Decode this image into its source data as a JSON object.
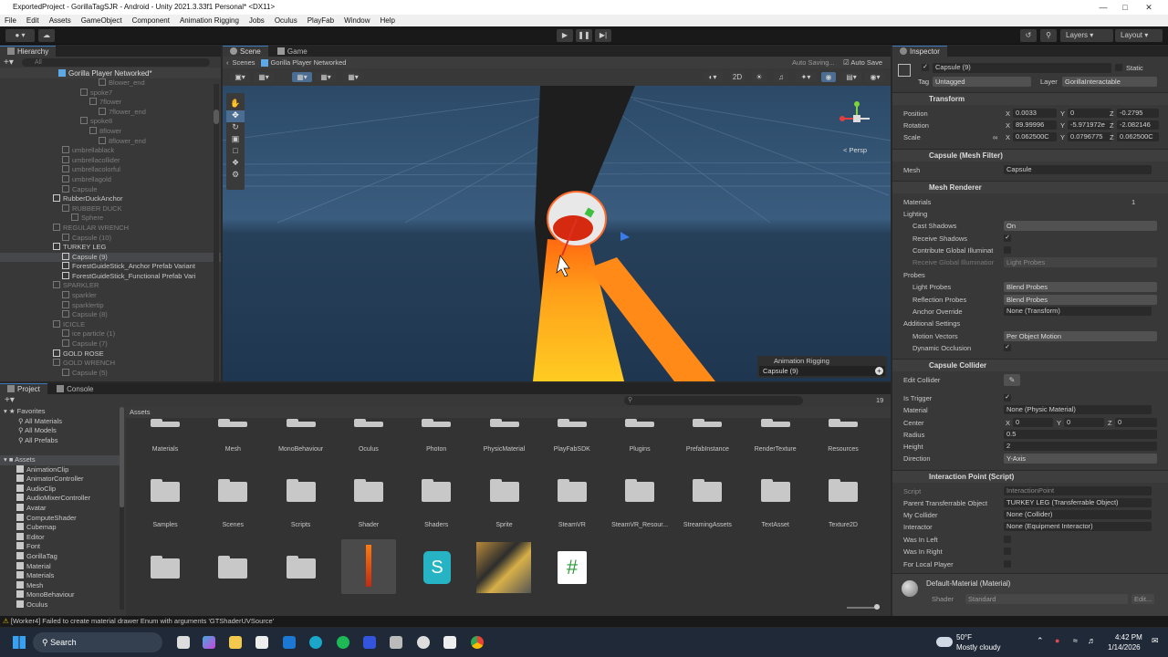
{
  "titlebar": {
    "title": "ExportedProject - GorillaTagSJR - Android - Unity 2021.3.33f1 Personal* <DX11>"
  },
  "menu": [
    "File",
    "Edit",
    "Assets",
    "GameObject",
    "Component",
    "Animation Rigging",
    "Jobs",
    "Oculus",
    "PlayFab",
    "Window",
    "Help"
  ],
  "toolbar": {
    "layers": "Layers",
    "layout": "Layout"
  },
  "hierarchy": {
    "tab": "Hierarchy",
    "search_placeholder": "All",
    "scene_name": "Gorilla Player Networked*",
    "rows": [
      {
        "label": "Blower_end",
        "indent": 9,
        "dim": true
      },
      {
        "label": "spoke7",
        "indent": 7,
        "dim": true
      },
      {
        "label": "7flower",
        "indent": 8,
        "dim": true
      },
      {
        "label": "7flower_end",
        "indent": 9,
        "dim": true
      },
      {
        "label": "spoke8",
        "indent": 7,
        "dim": true
      },
      {
        "label": "8flower",
        "indent": 8,
        "dim": true
      },
      {
        "label": "8flower_end",
        "indent": 9,
        "dim": true
      },
      {
        "label": "umbrellablack",
        "indent": 5,
        "dim": true
      },
      {
        "label": "umbrellacollider",
        "indent": 5,
        "dim": true
      },
      {
        "label": "umbrellacolorful",
        "indent": 5,
        "dim": true
      },
      {
        "label": "umbrellagold",
        "indent": 5,
        "dim": true
      },
      {
        "label": "Capsule",
        "indent": 5,
        "dim": true
      },
      {
        "label": "RubberDuckAnchor",
        "indent": 4,
        "dim": false
      },
      {
        "label": "RUBBER DUCK",
        "indent": 5,
        "dim": true
      },
      {
        "label": "Sphere",
        "indent": 6,
        "dim": true
      },
      {
        "label": "REGULAR WRENCH",
        "indent": 4,
        "dim": true
      },
      {
        "label": "Capsule (10)",
        "indent": 5,
        "dim": true
      },
      {
        "label": "TURKEY LEG",
        "indent": 4,
        "dim": false
      },
      {
        "label": "Capsule (9)",
        "indent": 5,
        "dim": false,
        "selected": true
      },
      {
        "label": "ForestGuideStick_Anchor Prefab Variant",
        "indent": 5,
        "dim": false
      },
      {
        "label": "ForestGuideStick_Functional Prefab Vari",
        "indent": 5,
        "dim": false
      },
      {
        "label": "SPARKLER",
        "indent": 4,
        "dim": true
      },
      {
        "label": "sparkler",
        "indent": 5,
        "dim": true
      },
      {
        "label": "sparklertip",
        "indent": 5,
        "dim": true
      },
      {
        "label": "Capsule (8)",
        "indent": 5,
        "dim": true
      },
      {
        "label": "ICICLE",
        "indent": 4,
        "dim": true
      },
      {
        "label": "ice particle (1)",
        "indent": 5,
        "dim": true
      },
      {
        "label": "Capsule (7)",
        "indent": 5,
        "dim": true
      },
      {
        "label": "GOLD ROSE",
        "indent": 4,
        "dim": false
      },
      {
        "label": "GOLD WRENCH",
        "indent": 4,
        "dim": true
      },
      {
        "label": "Capsule (5)",
        "indent": 5,
        "dim": true
      }
    ]
  },
  "scene": {
    "tabs": [
      "Scene",
      "Game"
    ],
    "sub_label": "Scenes",
    "prefab_name": "Gorilla Player Networked",
    "auto_saving": "Auto Saving...",
    "auto_save": "Auto Save",
    "mode_2d": "2D",
    "persp": "< Persp",
    "overlay_title": "Animation Rigging",
    "overlay_item": "Capsule (9)"
  },
  "project": {
    "tabs": [
      "Project",
      "Console"
    ],
    "breadcrumb": "Assets",
    "count_badge": "19",
    "favorites": "Favorites",
    "fav_items": [
      "All Materials",
      "All Models",
      "All Prefabs"
    ],
    "assets_root": "Assets",
    "tree": [
      "AnimationClip",
      "AnimatorController",
      "AudioClip",
      "AudioMixerController",
      "Avatar",
      "ComputeShader",
      "Cubemap",
      "Editor",
      "Font",
      "GorillaTag",
      "Material",
      "Materials",
      "Mesh",
      "MonoBehaviour",
      "Oculus"
    ],
    "grid_row1": [
      "Materials",
      "Mesh",
      "MonoBehaviour",
      "Oculus",
      "Photon",
      "PhysicMaterial",
      "PlayFabSDK",
      "Plugins",
      "PrefabInstance",
      "RenderTexture",
      "Resources"
    ],
    "grid_row2": [
      "Samples",
      "Scenes",
      "Scripts",
      "Shader",
      "Shaders",
      "Sprite",
      "SteamVR",
      "SteamVR_Resour...",
      "StreamingAssets",
      "TextAsset",
      "Texture2D"
    ]
  },
  "inspector": {
    "tab": "Inspector",
    "object_name": "Capsule (9)",
    "static_label": "Static",
    "tag_label": "Tag",
    "tag_value": "Untagged",
    "layer_label": "Layer",
    "layer_value": "GorillaInteractable",
    "transform": {
      "title": "Transform",
      "position_label": "Position",
      "pos_x": "0.0033",
      "pos_y": "0",
      "pos_z": "-0.2795",
      "rotation_label": "Rotation",
      "rot_x": "89.99996",
      "rot_y": "-5.971972e",
      "rot_z": "-2.082146",
      "scale_label": "Scale",
      "sc_x": "0.062500C",
      "sc_y": "0.0796775",
      "sc_z": "0.062500C"
    },
    "mesh_filter": {
      "title": "Capsule (Mesh Filter)",
      "mesh_label": "Mesh",
      "mesh_value": "Capsule"
    },
    "mesh_renderer": {
      "title": "Mesh Renderer",
      "materials_label": "Materials",
      "materials_count": "1",
      "lighting_label": "Lighting",
      "cast_shadows_label": "Cast Shadows",
      "cast_shadows_value": "On",
      "receive_shadows_label": "Receive Shadows",
      "contribute_gi_label": "Contribute Global Illuminat",
      "receive_gi_label": "Receive Global Illuminatior",
      "receive_gi_value": "Light Probes",
      "probes_label": "Probes",
      "light_probes_label": "Light Probes",
      "light_probes_value": "Blend Probes",
      "reflection_probes_label": "Reflection Probes",
      "reflection_probes_value": "Blend Probes",
      "anchor_override_label": "Anchor Override",
      "anchor_override_value": "None (Transform)",
      "additional_label": "Additional Settings",
      "motion_vectors_label": "Motion Vectors",
      "motion_vectors_value": "Per Object Motion",
      "dynamic_occlusion_label": "Dynamic Occlusion"
    },
    "capsule_collider": {
      "title": "Capsule Collider",
      "edit_label": "Edit Collider",
      "is_trigger_label": "Is Trigger",
      "material_label": "Material",
      "material_value": "None (Physic Material)",
      "center_label": "Center",
      "c_x": "0",
      "c_y": "0",
      "c_z": "0",
      "radius_label": "Radius",
      "radius_value": "0.5",
      "height_label": "Height",
      "height_value": "2",
      "direction_label": "Direction",
      "direction_value": "Y-Axis"
    },
    "interaction_point": {
      "title": "Interaction Point (Script)",
      "script_label": "Script",
      "script_value": "InteractionPoint",
      "parent_label": "Parent Transferrable Object",
      "parent_value": "TURKEY LEG (Transferrable Object)",
      "my_collider_label": "My Collider",
      "my_collider_value": "None (Collider)",
      "interactor_label": "Interactor",
      "interactor_value": "None (Equipment Interactor)",
      "was_in_left_label": "Was In Left",
      "was_in_right_label": "Was In Right",
      "for_local_label": "For Local Player"
    },
    "material": {
      "title": "Default-Material (Material)",
      "shader_label": "Shader",
      "shader_value": "Standard",
      "edit": "Edit..."
    }
  },
  "status": {
    "message": "[Worker4] Failed to create material drawer Enum with arguments 'GTShaderUVSource'"
  },
  "taskbar": {
    "search": "Search",
    "weather_temp": "50°F",
    "weather_desc": "Mostly cloudy",
    "time": "4:42 PM",
    "date": "1/14/2026"
  }
}
